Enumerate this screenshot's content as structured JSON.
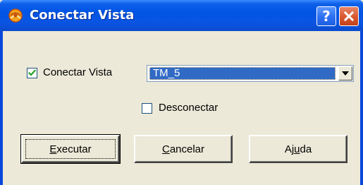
{
  "window": {
    "title": "Conectar Vista",
    "help_button_label": "?",
    "close_button_label": "✕"
  },
  "form": {
    "connect_checkbox": {
      "label": "Conectar Vista",
      "checked": true
    },
    "vista_select": {
      "selected_value": "TM_5"
    },
    "disconnect_checkbox": {
      "label": "Desconectar",
      "checked": false
    }
  },
  "buttons": {
    "execute": {
      "mnemonic": "E",
      "rest": "xecutar"
    },
    "cancel": {
      "mnemonic": "C",
      "rest": "ancelar"
    },
    "help": {
      "before": "Aj",
      "mnemonic": "u",
      "rest": "da"
    }
  },
  "colors": {
    "titlebar": "#0054e3",
    "dialog_background": "#ece9d8",
    "selection_highlight": "#316ac5",
    "close_button": "#d9572e"
  }
}
